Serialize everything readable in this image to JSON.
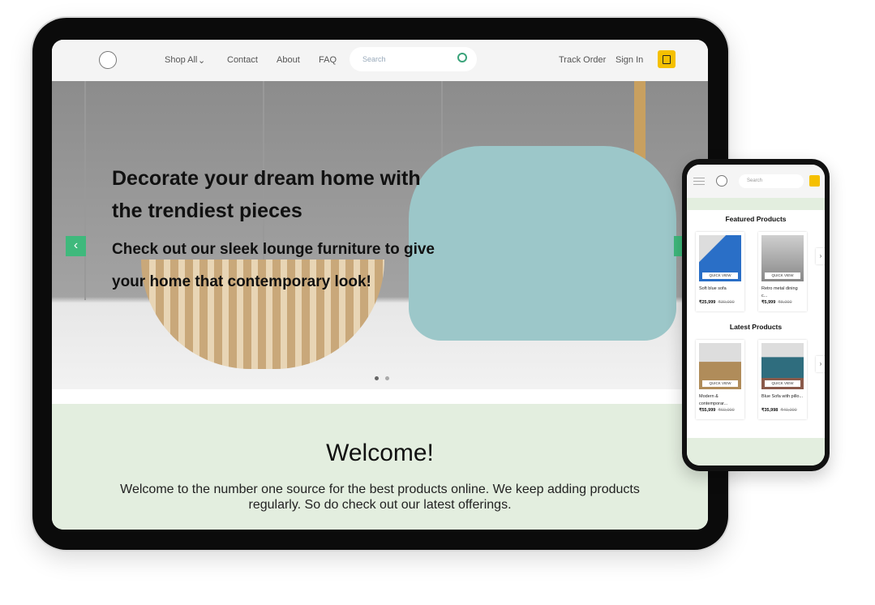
{
  "nav": {
    "items": [
      "Shop All",
      "Contact",
      "About",
      "FAQ"
    ],
    "search_placeholder": "Search",
    "track_order": "Track Order",
    "sign_in": "Sign In"
  },
  "hero": {
    "headline": "Decorate your dream home with the trendiest pieces",
    "subline": "Check out our sleek lounge furniture to give your home that contemporary look!",
    "prev": "‹",
    "next": "›"
  },
  "welcome": {
    "title": "Welcome!",
    "text": "Welcome to the number one source for the best products online. We keep adding products regularly. So do check out our latest offerings."
  },
  "mobile": {
    "search_placeholder": "Search",
    "quick_view": "QUICK VIEW",
    "featured": {
      "title": "Featured Products",
      "products": [
        {
          "name": "Soft blue sofa",
          "price": "₹25,999",
          "old_price": "₹30,000"
        },
        {
          "name": "Retro metal dining c...",
          "price": "₹5,999",
          "old_price": "₹8,000"
        }
      ]
    },
    "latest": {
      "title": "Latest Products",
      "products": [
        {
          "name": "Modern & contemporar...",
          "price": "₹55,999",
          "old_price": "₹60,000"
        },
        {
          "name": "Blue Sofa with pillo...",
          "price": "₹35,998",
          "old_price": "₹40,000"
        }
      ]
    }
  },
  "colors": {
    "accent": "#3fb97c",
    "cart": "#f5c000",
    "welcome_bg": "#e3eedf"
  }
}
